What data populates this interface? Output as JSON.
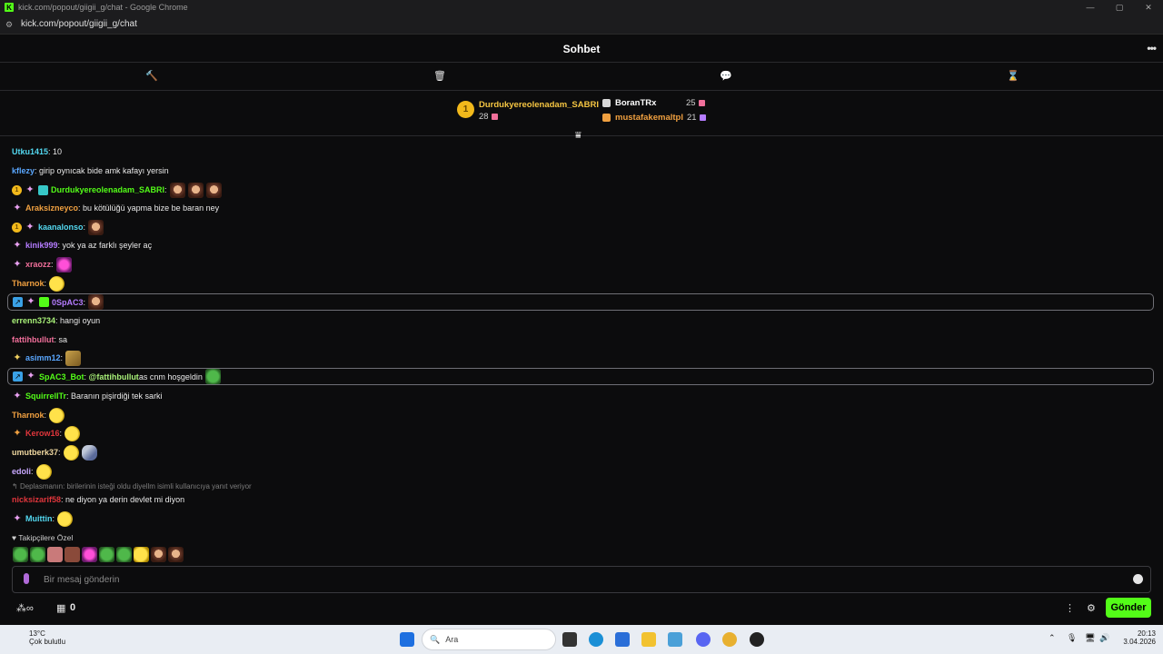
{
  "browser": {
    "title": "kick.com/popout/giigii_g/chat - Google Chrome",
    "url": "kick.com/popout/giigii_g/chat"
  },
  "header": {
    "title": "Sohbet"
  },
  "leaderboard": {
    "first": {
      "rank": "1",
      "name": "Durdukyereolenadam_SABRI",
      "count": "28"
    },
    "second": {
      "name": "BoranTRx",
      "count": "25"
    },
    "third": {
      "name": "mustafakemaltpl",
      "count": "21"
    }
  },
  "messages": [
    {
      "user": "Utku1415",
      "text": ": 10",
      "color": "#53d8f0"
    },
    {
      "user": "kflezy",
      "text": ": girip oynıcak bide amk kafayı yersin",
      "color": "#5aa7ff"
    },
    {
      "user": "Durdukyereolenadam_SABRI",
      "text": ":",
      "color": "#53fc18"
    },
    {
      "user": "Araksizneyco",
      "text": ": bu kötülüğü yapma bize be baran ney",
      "color": "#f0a040"
    },
    {
      "user": "kaanalonso",
      "text": ":",
      "color": "#53d8f0"
    },
    {
      "user": "kinik999",
      "text": ": yok ya az farklı şeyler aç",
      "color": "#b57cff"
    },
    {
      "user": "xraozz",
      "text": ":",
      "color": "#f06f9a"
    },
    {
      "user": "Tharnok",
      "text": ":",
      "color": "#f0a040"
    },
    {
      "user": "0SpAC3",
      "text": ":",
      "color": "#b57cff"
    },
    {
      "user": "errenn3734",
      "text": ": hangi oyun",
      "color": "#a8f078"
    },
    {
      "user": "fattihbullut",
      "text": ": sa",
      "color": "#f06f9a"
    },
    {
      "user": "asimm12",
      "text": ":",
      "color": "#5aa7ff"
    },
    {
      "user": "SpAC3_Bot",
      "text": ":",
      "mention": "@fattihbullut",
      "after": " as cnm hoşgeldin",
      "color": "#53fc18"
    },
    {
      "user": "SquirrelITr",
      "text": ": Baranın pişirdiği tek sarki",
      "color": "#53fc18"
    },
    {
      "user": "Tharnok",
      "text": ":",
      "color": "#f0a040"
    },
    {
      "user": "Kerow16",
      "text": ":",
      "color": "#e0363c"
    },
    {
      "user": "umutberk37",
      "text": ":",
      "color": "#f0d8a0"
    },
    {
      "user": "edoli",
      "text": ":",
      "color": "#c8a8ff"
    },
    {
      "user": "nicksizarif58",
      "text": ": ne diyon ya derin devlet mi diyon",
      "color": "#e0363c"
    },
    {
      "user": "Muittin",
      "text": ":",
      "color": "#53d8f0"
    }
  ],
  "reply_note": "Deplasmanın: birilerinin isteği oldu diyellm isimli kullanıcıya yanıt veriyor",
  "followers_label": "Takipçilere Özel",
  "input": {
    "placeholder": "Bir mesaj gönderin"
  },
  "footer": {
    "points": "0",
    "send_label": "Gönder"
  },
  "taskbar": {
    "temp": "13°C",
    "weather": "Çok bulutlu",
    "search": "Ara",
    "time": "20:13",
    "date": "3.04.2026"
  }
}
